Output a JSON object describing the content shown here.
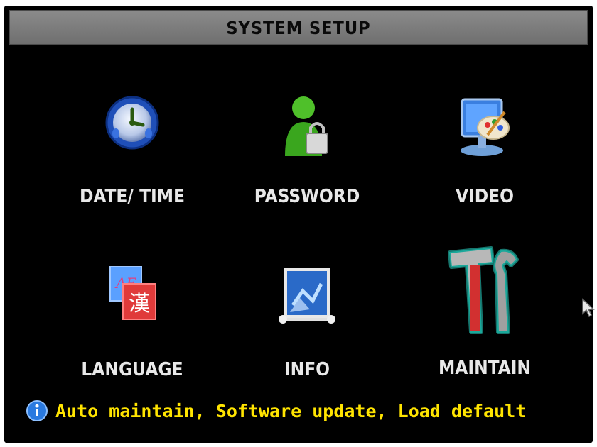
{
  "header": {
    "title": "SYSTEM SETUP"
  },
  "menu": {
    "items": [
      {
        "label": "DATE/ TIME",
        "icon": "clock-icon"
      },
      {
        "label": "PASSWORD",
        "icon": "user-lock-icon"
      },
      {
        "label": "VIDEO",
        "icon": "monitor-palette-icon"
      },
      {
        "label": "LANGUAGE",
        "icon": "language-icon"
      },
      {
        "label": "INFO",
        "icon": "info-board-icon"
      },
      {
        "label": "MAINTAIN",
        "icon": "tools-icon"
      }
    ],
    "selected": "MAINTAIN"
  },
  "status": {
    "text": "Auto maintain, Software update, Load default"
  },
  "colors": {
    "background": "#000000",
    "titlebar": "#7a7a7a",
    "status_text": "#ffe400",
    "selection_glow": "#2ad8c8"
  }
}
